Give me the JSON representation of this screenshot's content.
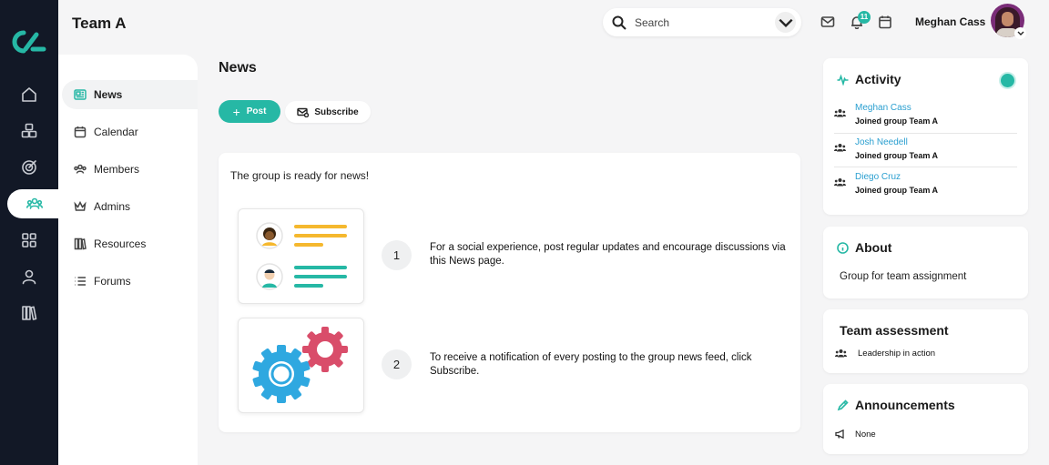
{
  "app": {
    "team_title": "Team A"
  },
  "header": {
    "search_placeholder": "Search",
    "notification_count": "11",
    "user_name": "Meghan Cass"
  },
  "rail": {
    "icons": [
      "home-icon",
      "cubes-icon",
      "target-icon",
      "group-icon",
      "grid-icon",
      "user-icon",
      "library-icon"
    ],
    "active": "group-icon"
  },
  "sidebar": {
    "items": [
      {
        "label": "News",
        "icon": "news-icon",
        "active": true
      },
      {
        "label": "Calendar",
        "icon": "calendar-icon"
      },
      {
        "label": "Members",
        "icon": "members-icon"
      },
      {
        "label": "Admins",
        "icon": "crown-icon"
      },
      {
        "label": "Resources",
        "icon": "books-icon"
      },
      {
        "label": "Forums",
        "icon": "list-icon"
      }
    ]
  },
  "main": {
    "title": "News",
    "post_label": "Post",
    "subscribe_label": "Subscribe",
    "ready_text": "The group is ready for news!",
    "steps": [
      {
        "number": "1",
        "text": "For a social experience, post regular updates and encourage discussions via this News page."
      },
      {
        "number": "2",
        "text": "To receive a notification of every posting to the group news feed, click Subscribe."
      }
    ]
  },
  "activity": {
    "title": "Activity",
    "items": [
      {
        "name": "Meghan Cass",
        "desc": "Joined group Team A"
      },
      {
        "name": "Josh Needell",
        "desc": "Joined group Team A"
      },
      {
        "name": "Diego Cruz",
        "desc": "Joined group Team A"
      }
    ]
  },
  "about": {
    "title": "About",
    "text": "Group for team assignment"
  },
  "assessment": {
    "title": "Team assessment",
    "item": "Leadership in action"
  },
  "announcements": {
    "title": "Announcements",
    "text": "None"
  },
  "colors": {
    "accent": "#26b8a5",
    "rail": "#121826",
    "link": "#2a9fd0",
    "yellow": "#f5b82e",
    "gear_blue": "#2fa8e0",
    "gear_red": "#d94d6a"
  }
}
